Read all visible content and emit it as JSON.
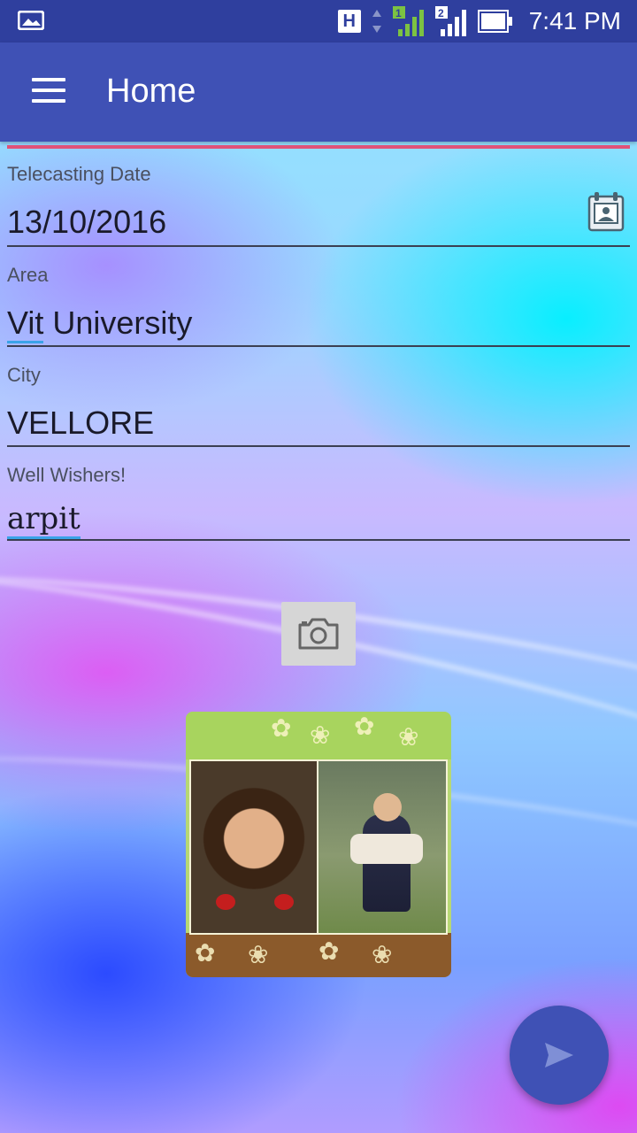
{
  "status_bar": {
    "time": "7:41 PM",
    "network_badge": "H",
    "sim1": "1",
    "sim2": "2"
  },
  "app_bar": {
    "title": "Home"
  },
  "form": {
    "telecasting_date": {
      "label": "Telecasting Date",
      "value": "13/10/2016"
    },
    "area": {
      "label": "Area",
      "value_first": "Vit",
      "value_rest": " University"
    },
    "city": {
      "label": "City",
      "value": "VELLORE"
    },
    "well_wishers": {
      "label": "Well Wishers!",
      "value": "arpit"
    }
  },
  "icons": {
    "menu": "hamburger-menu-icon",
    "calendar": "calendar-icon",
    "camera": "camera-icon",
    "send": "send-icon"
  },
  "colors": {
    "primary": "#3f51b5",
    "status_bar": "#2f3f9e",
    "accent_line": "#e05278",
    "spell_underline": "#3aa3e8"
  }
}
